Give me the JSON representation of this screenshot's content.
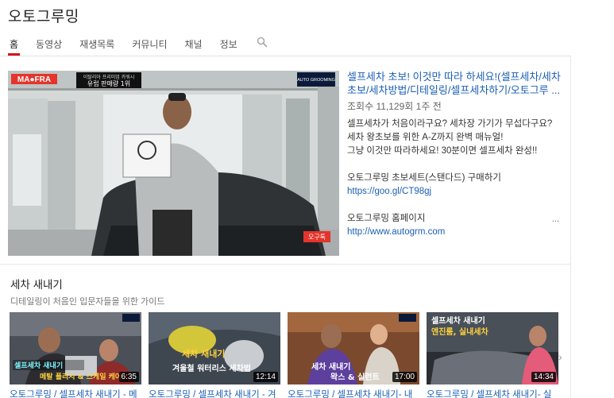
{
  "channel": {
    "title": "오토그루밍"
  },
  "tabs": [
    {
      "label": "홈",
      "active": true
    },
    {
      "label": "동영상"
    },
    {
      "label": "재생목록"
    },
    {
      "label": "커뮤니티"
    },
    {
      "label": "채널"
    },
    {
      "label": "정보"
    }
  ],
  "featured": {
    "title": "셀프세차 초보! 이것만 따라 하세요!(셀프세차/세차초보/세차방법/디테일링/셀프세차하기/오토그루 ...",
    "meta": "조회수 11,129회  1주 전",
    "desc_line1": "셀프세차가 처음이라구요? 세차장 가기가 무섭다구요?",
    "desc_line2": "세차 왕초보를 위한 A-Z까지 완벽 매뉴얼!",
    "desc_line3": "그냥 이것만 따라하세요! 30분이면 셀프세차 완성!!",
    "desc_line4": "오토그루밍 초보세트(스탠다드) 구매하기",
    "link1": "https://goo.gl/CT98gj",
    "desc_line5": "오토그루밍 홈페이지",
    "link2": "http://www.autogrm.com",
    "more": "...",
    "thumb": {
      "logo_left": "MA●FRA",
      "banner_top": "이탈리아 프리미엄 카워시",
      "banner_bottom": "유럽 판매량 1위",
      "logo_right": "AUTO GROOMING",
      "bottom_logo": "오구톡"
    }
  },
  "shelf": {
    "title": "세차 새내기",
    "subtitle": "디테일링이 처음인 입문자들을 위한 가이드",
    "cards": [
      {
        "title": "오토그루밍 / 셀프세차 새내기 - 메",
        "duration": "6:35",
        "overlay1": "셀프세차 새내기",
        "overlay2": "메탈 폴리시 & 스케일 케어"
      },
      {
        "title": "오토그루밍 / 셀프세차 새내기 - 겨",
        "duration": "12:14",
        "overlay1": "세차 새내기",
        "overlay2": "겨울철 워터리스 세차법"
      },
      {
        "title": "오토그루밍 / 셀프세차 새내기- 내",
        "duration": "17:00",
        "overlay1": "세차 새내기",
        "overlay2": "왁스 & 실런트"
      },
      {
        "title": "오토그루밍 / 셀프세차 새내기- 실",
        "duration": "14:34",
        "overlay1": "셀프세차 새내기",
        "overlay2": "엔진룸, 실내세차"
      }
    ]
  },
  "colors": {
    "link": "#1a5fb4",
    "accent": "#cc181e"
  }
}
